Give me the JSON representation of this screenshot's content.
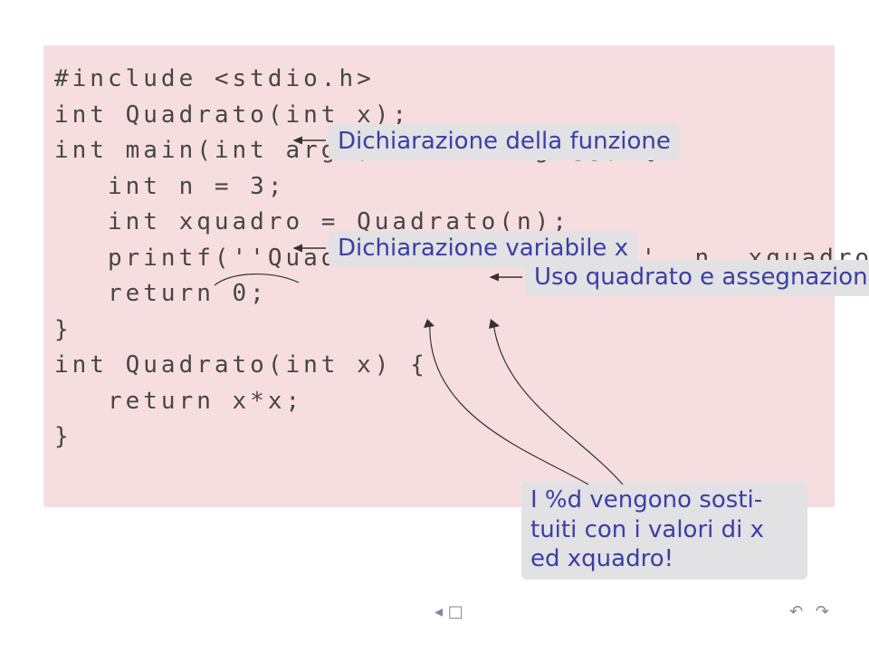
{
  "code": {
    "l1": "#include <stdio.h>",
    "l2": "",
    "l3": "int Quadrato(int x);",
    "l4": "",
    "l5": "int main(int argc, char *argv[]) {",
    "l6": "   int n = 3;",
    "l6b": "Dichiarazione variabile x",
    "l7": "   int xquadro = Quadrato(n);",
    "l8": "   printf(''Quadrato di %d: %d\\n'', n, xquadro);",
    "l9": "   return 0;",
    "l10": "}",
    "l11": "",
    "l12": "int Quadrato(int x) {",
    "l13": "   return x*x;",
    "l14": "}"
  },
  "annotations": {
    "decl_func": "Dichiarazione della funzione",
    "decl_var": "Dichiarazione variabile x",
    "use_assign": "Uso quadrato e assegnazione",
    "subst": "I %d vengono sosti-\ntuiti con i valori di x\ned xquadro!"
  },
  "nav": {
    "left_glyph": "◂ □",
    "right_glyphs": "↶ ↷"
  }
}
